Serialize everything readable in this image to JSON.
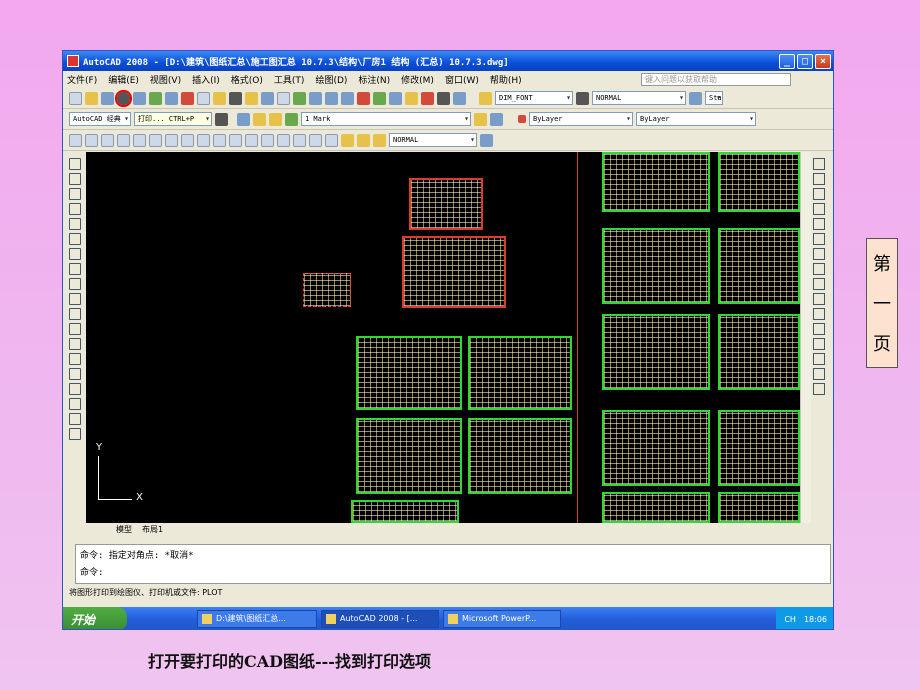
{
  "window": {
    "title": "AutoCAD 2008 - [D:\\建筑\\图纸汇总\\施工图汇总 10.7.3\\结构\\厂房1 结构 (汇总) 10.7.3.dwg]",
    "min": "_",
    "max": "□",
    "close": "×"
  },
  "menu": {
    "items": [
      "文件(F)",
      "编辑(E)",
      "视图(V)",
      "插入(I)",
      "格式(O)",
      "工具(T)",
      "绘图(D)",
      "标注(N)",
      "修改(M)",
      "窗口(W)",
      "帮助(H)"
    ],
    "help_placeholder": "键入问题以获取帮助"
  },
  "toolbar": {
    "text_style": "DIM_FONT",
    "dim_style": "NORMAL",
    "table_style": "Sta",
    "workspace": "AutoCAD 经典",
    "print_tooltip": "打印...  CTRL+P",
    "layer": "1 Mark",
    "color": "ByLayer",
    "linetype": "ByLayer",
    "scale_style": "NORMAL"
  },
  "tabs": [
    "模型",
    "布局1"
  ],
  "ucs": {
    "x": "X",
    "y": "Y"
  },
  "command": {
    "line1": "命令: 指定对角点: *取消*",
    "line2": "命令:"
  },
  "status": "将图形打印到绘图仪、打印机或文件:  PLOT",
  "taskbar": {
    "start": "开始",
    "tasks": [
      "D:\\建筑\\图纸汇总...",
      "AutoCAD 2008 - [...",
      "Microsoft PowerP..."
    ],
    "lang": "CH",
    "time": "18:06"
  },
  "side_label": [
    "第",
    "一",
    "页"
  ],
  "caption": "打开要打印的CAD图纸---找到打印选项"
}
